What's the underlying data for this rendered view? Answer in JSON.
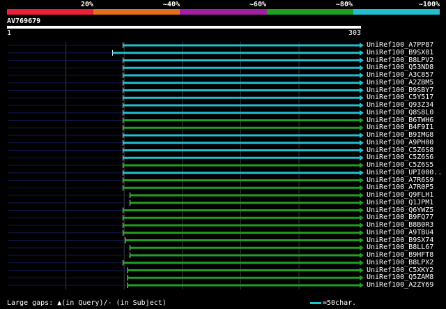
{
  "legend": {
    "labels": [
      "20%",
      "~40%",
      "~60%",
      "~80%",
      "~100%"
    ],
    "colors": [
      "#e8203a",
      "#e07020",
      "#a020a0",
      "#20a020",
      "#20c0d0"
    ]
  },
  "query": {
    "id": "AV769679",
    "start": "1",
    "end": "303",
    "length": 303
  },
  "hit_colors": {
    "cyan": "#20c0d0",
    "green": "#20a020",
    "track": "#101850",
    "start_bar": "#ffffff"
  },
  "hits": [
    {
      "label": "UniRef100_A7PP87",
      "start": 100,
      "end": 303,
      "color": "cyan"
    },
    {
      "label": "UniRef100_B9SX01",
      "start": 91,
      "end": 303,
      "color": "cyan"
    },
    {
      "label": "UniRef100_B8LPV2",
      "start": 100,
      "end": 303,
      "color": "cyan"
    },
    {
      "label": "UniRef100_Q53ND8",
      "start": 100,
      "end": 303,
      "color": "cyan"
    },
    {
      "label": "UniRef100_A3C857",
      "start": 100,
      "end": 303,
      "color": "cyan"
    },
    {
      "label": "UniRef100_A2ZBM5",
      "start": 100,
      "end": 303,
      "color": "cyan"
    },
    {
      "label": "UniRef100_B9SBY7",
      "start": 100,
      "end": 303,
      "color": "cyan"
    },
    {
      "label": "UniRef100_C5Y517",
      "start": 100,
      "end": 303,
      "color": "cyan"
    },
    {
      "label": "UniRef100_Q93Z34",
      "start": 100,
      "end": 303,
      "color": "cyan"
    },
    {
      "label": "UniRef100_Q8S8L0",
      "start": 100,
      "end": 303,
      "color": "cyan"
    },
    {
      "label": "UniRef100_B6TWH6",
      "start": 100,
      "end": 303,
      "color": "green"
    },
    {
      "label": "UniRef100_B4F9I1",
      "start": 100,
      "end": 303,
      "color": "green"
    },
    {
      "label": "UniRef100_B9IMG8",
      "start": 100,
      "end": 303,
      "color": "cyan"
    },
    {
      "label": "UniRef100_A9PH00",
      "start": 100,
      "end": 303,
      "color": "cyan"
    },
    {
      "label": "UniRef100_C5Z6S8",
      "start": 100,
      "end": 303,
      "color": "cyan"
    },
    {
      "label": "UniRef100_C5Z6S6",
      "start": 100,
      "end": 303,
      "color": "cyan"
    },
    {
      "label": "UniRef100_C5Z6S5",
      "start": 100,
      "end": 303,
      "color": "green"
    },
    {
      "label": "UniRef100_UPI000..",
      "start": 100,
      "end": 303,
      "color": "cyan"
    },
    {
      "label": "UniRef100_A7R6S9",
      "start": 100,
      "end": 303,
      "color": "green"
    },
    {
      "label": "UniRef100_A7R0P5",
      "start": 100,
      "end": 303,
      "color": "green"
    },
    {
      "label": "UniRef100_Q9FLH1",
      "start": 106,
      "end": 303,
      "color": "green"
    },
    {
      "label": "UniRef100_Q1JPM1",
      "start": 106,
      "end": 303,
      "color": "green"
    },
    {
      "label": "UniRef100_Q6YWZ5",
      "start": 100,
      "end": 303,
      "color": "green"
    },
    {
      "label": "UniRef100_B9FQ77",
      "start": 100,
      "end": 303,
      "color": "green"
    },
    {
      "label": "UniRef100_B8B0R3",
      "start": 100,
      "end": 303,
      "color": "green"
    },
    {
      "label": "UniRef100_A9TBU4",
      "start": 100,
      "end": 303,
      "color": "green"
    },
    {
      "label": "UniRef100_B9SX74",
      "start": 102,
      "end": 303,
      "color": "green"
    },
    {
      "label": "UniRef100_B8LL67",
      "start": 106,
      "end": 303,
      "color": "green"
    },
    {
      "label": "UniRef100_B9HFT8",
      "start": 106,
      "end": 303,
      "color": "green"
    },
    {
      "label": "UniRef100_B8LPX2",
      "start": 100,
      "end": 303,
      "color": "green"
    },
    {
      "label": "UniRef100_C5XKY2",
      "start": 104,
      "end": 303,
      "color": "green"
    },
    {
      "label": "UniRef100_Q5ZAM8",
      "start": 104,
      "end": 303,
      "color": "green"
    },
    {
      "label": "UniRef100_A2ZY69",
      "start": 104,
      "end": 303,
      "color": "green"
    }
  ],
  "footer": {
    "gaps_text": "Large gaps: ▲(in Query)/- (in Subject)",
    "scale_text": "=50char."
  }
}
